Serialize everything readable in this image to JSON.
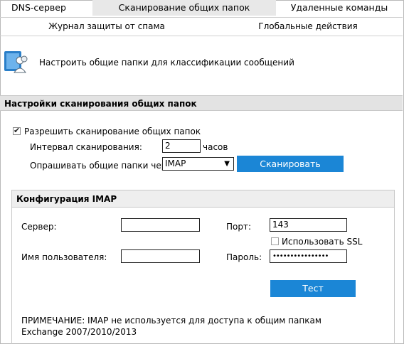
{
  "tabs": {
    "row1": [
      "DNS-сервер",
      "Сканирование общих папок",
      "Удаленные команды"
    ],
    "row2": [
      "Журнал защиты от спама",
      "Глобальные действия"
    ]
  },
  "intro": {
    "icon": "users-folder-icon",
    "text": "Настроить общие папки для классификации сообщений"
  },
  "scan_settings": {
    "title": "Настройки сканирования общих папок",
    "enable_label": "Разрешить сканирование общих папок",
    "enable_checked": true,
    "interval_label": "Интервал сканирования:",
    "interval_value": "2",
    "interval_unit": "часов",
    "poll_label": "Опрашивать общие папки через:",
    "poll_value": "IMAP",
    "scan_button": "Сканировать"
  },
  "imap": {
    "title": "Конфигурация IMAP",
    "server_label": "Сервер:",
    "server_value": "",
    "port_label": "Порт:",
    "port_value": "143",
    "ssl_label": "Использовать SSL",
    "ssl_checked": false,
    "user_label": "Имя пользователя:",
    "user_value": "",
    "password_label": "Пароль:",
    "password_value": "••••••••••••••••",
    "test_button": "Тест",
    "note": "ПРИМЕЧАНИЕ: IMAP не используется для доступа к общим папкам Exchange 2007/2010/2013"
  },
  "colors": {
    "accent": "#1b86d6",
    "header_bg": "#e3e3e3",
    "active_tab_bg": "#e8e8e8"
  }
}
